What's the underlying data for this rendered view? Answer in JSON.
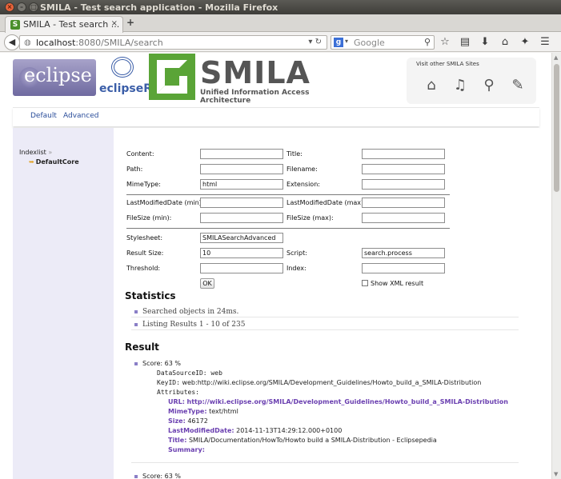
{
  "window": {
    "title": "SMILA - Test search application - Mozilla Firefox"
  },
  "tab": {
    "title": "SMILA - Test search ...",
    "close": "×",
    "new_tab": "+"
  },
  "address": {
    "host": "localhost",
    "rest": ":8080/SMILA/search"
  },
  "search_box": {
    "placeholder": "Google",
    "engine": "g"
  },
  "header": {
    "eclipse_logo": "eclipse",
    "eclipsert_logo": "eclipseRT",
    "smila_logo": "SMILA",
    "smila_tagline": "Unified Information Access Architecture",
    "other_sites_label": "Visit other SMILA Sites"
  },
  "nav": {
    "default": "Default",
    "advanced": "Advanced"
  },
  "sidebar": {
    "indexlist": "Indexlist",
    "chevron": "»",
    "core": "DefaultCore"
  },
  "form": {
    "content_label": "Content:",
    "title_label": "Title:",
    "path_label": "Path:",
    "filename_label": "Filename:",
    "mimetype_label": "MimeType:",
    "mimetype_value": "html",
    "extension_label": "Extension:",
    "lastmod_min_label": "LastModifiedDate (min):",
    "lastmod_max_label": "LastModifiedDate (max):",
    "filesize_min_label": "FileSize (min):",
    "filesize_max_label": "FileSize (max):",
    "stylesheet_label": "Stylesheet:",
    "stylesheet_value": "SMILASearchAdvanced",
    "result_size_label": "Result Size:",
    "result_size_value": "10",
    "script_label": "Script:",
    "script_value": "search.process",
    "threshold_label": "Threshold:",
    "index_label": "Index:",
    "ok": "OK",
    "show_xml": "Show XML result"
  },
  "statistics": {
    "heading": "Statistics",
    "searched": "Searched objects in 24ms.",
    "listing": "Listing Results 1 - 10 of 235"
  },
  "result": {
    "heading": "Result",
    "score": "Score: 63 %",
    "datasource": "DataSourceID: web",
    "keyid_label": "KeyID:",
    "keyid_value": "web:http://wiki.eclipse.org/SMILA/Development_Guidelines/Howto_build_a_SMILA-Distribution",
    "attributes": "Attributes:",
    "url_label": "URL:",
    "url_value": "http://wiki.eclipse.org/SMILA/Development_Guidelines/Howto_build_a_SMILA-Distribution",
    "mimetype_label": "MimeType:",
    "mimetype_value": "text/html",
    "size_label": "Size:",
    "size_value": "46172",
    "lastmod_label": "LastModifiedDate:",
    "lastmod_value": "2014-11-13T14:29:12.000+0100",
    "title_label": "Title:",
    "title_value": "SMILA/Documentation/HowTo/Howto build a SMILA-Distribution - Eclipsepedia",
    "summary_label": "Summary:",
    "score2": "Score: 63 %"
  }
}
